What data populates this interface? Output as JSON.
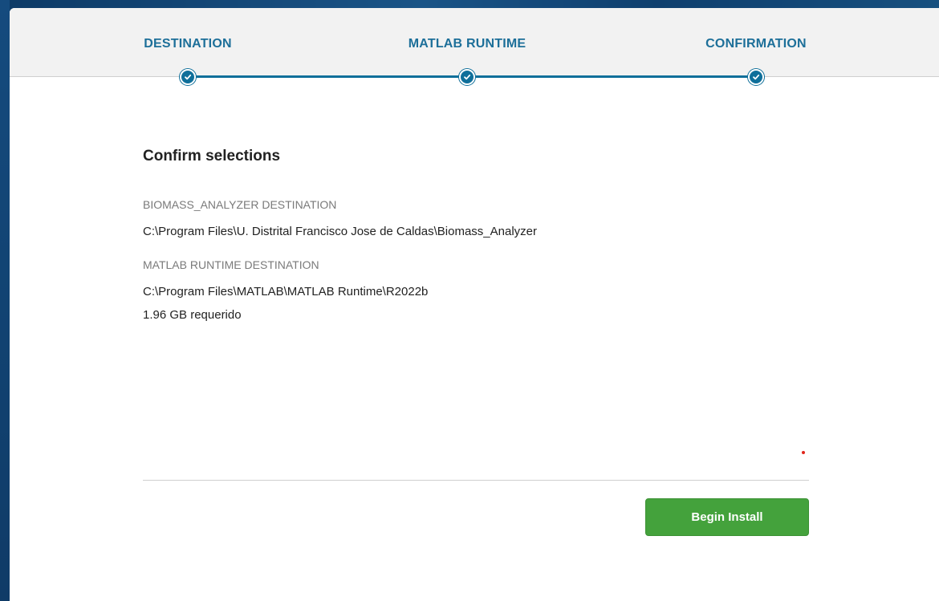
{
  "steps": {
    "items": [
      {
        "label": "DESTINATION",
        "state": "complete"
      },
      {
        "label": "MATLAB RUNTIME",
        "state": "complete"
      },
      {
        "label": "CONFIRMATION",
        "state": "current"
      }
    ],
    "icon": "checkmark-icon",
    "accent_color": "#0f6f9a",
    "label_color": "#1d6f99"
  },
  "main": {
    "title": "Confirm selections",
    "app_destination": {
      "label": "BIOMASS_ANALYZER DESTINATION",
      "path": "C:\\Program Files\\U. Distrital Francisco Jose de Caldas\\Biomass_Analyzer"
    },
    "runtime_destination": {
      "label": "MATLAB RUNTIME DESTINATION",
      "path": "C:\\Program Files\\MATLAB\\MATLAB Runtime\\R2022b",
      "space_required": "1.96 GB requerido"
    }
  },
  "footer": {
    "install_label": "Begin Install",
    "install_color": "#44a23c"
  }
}
